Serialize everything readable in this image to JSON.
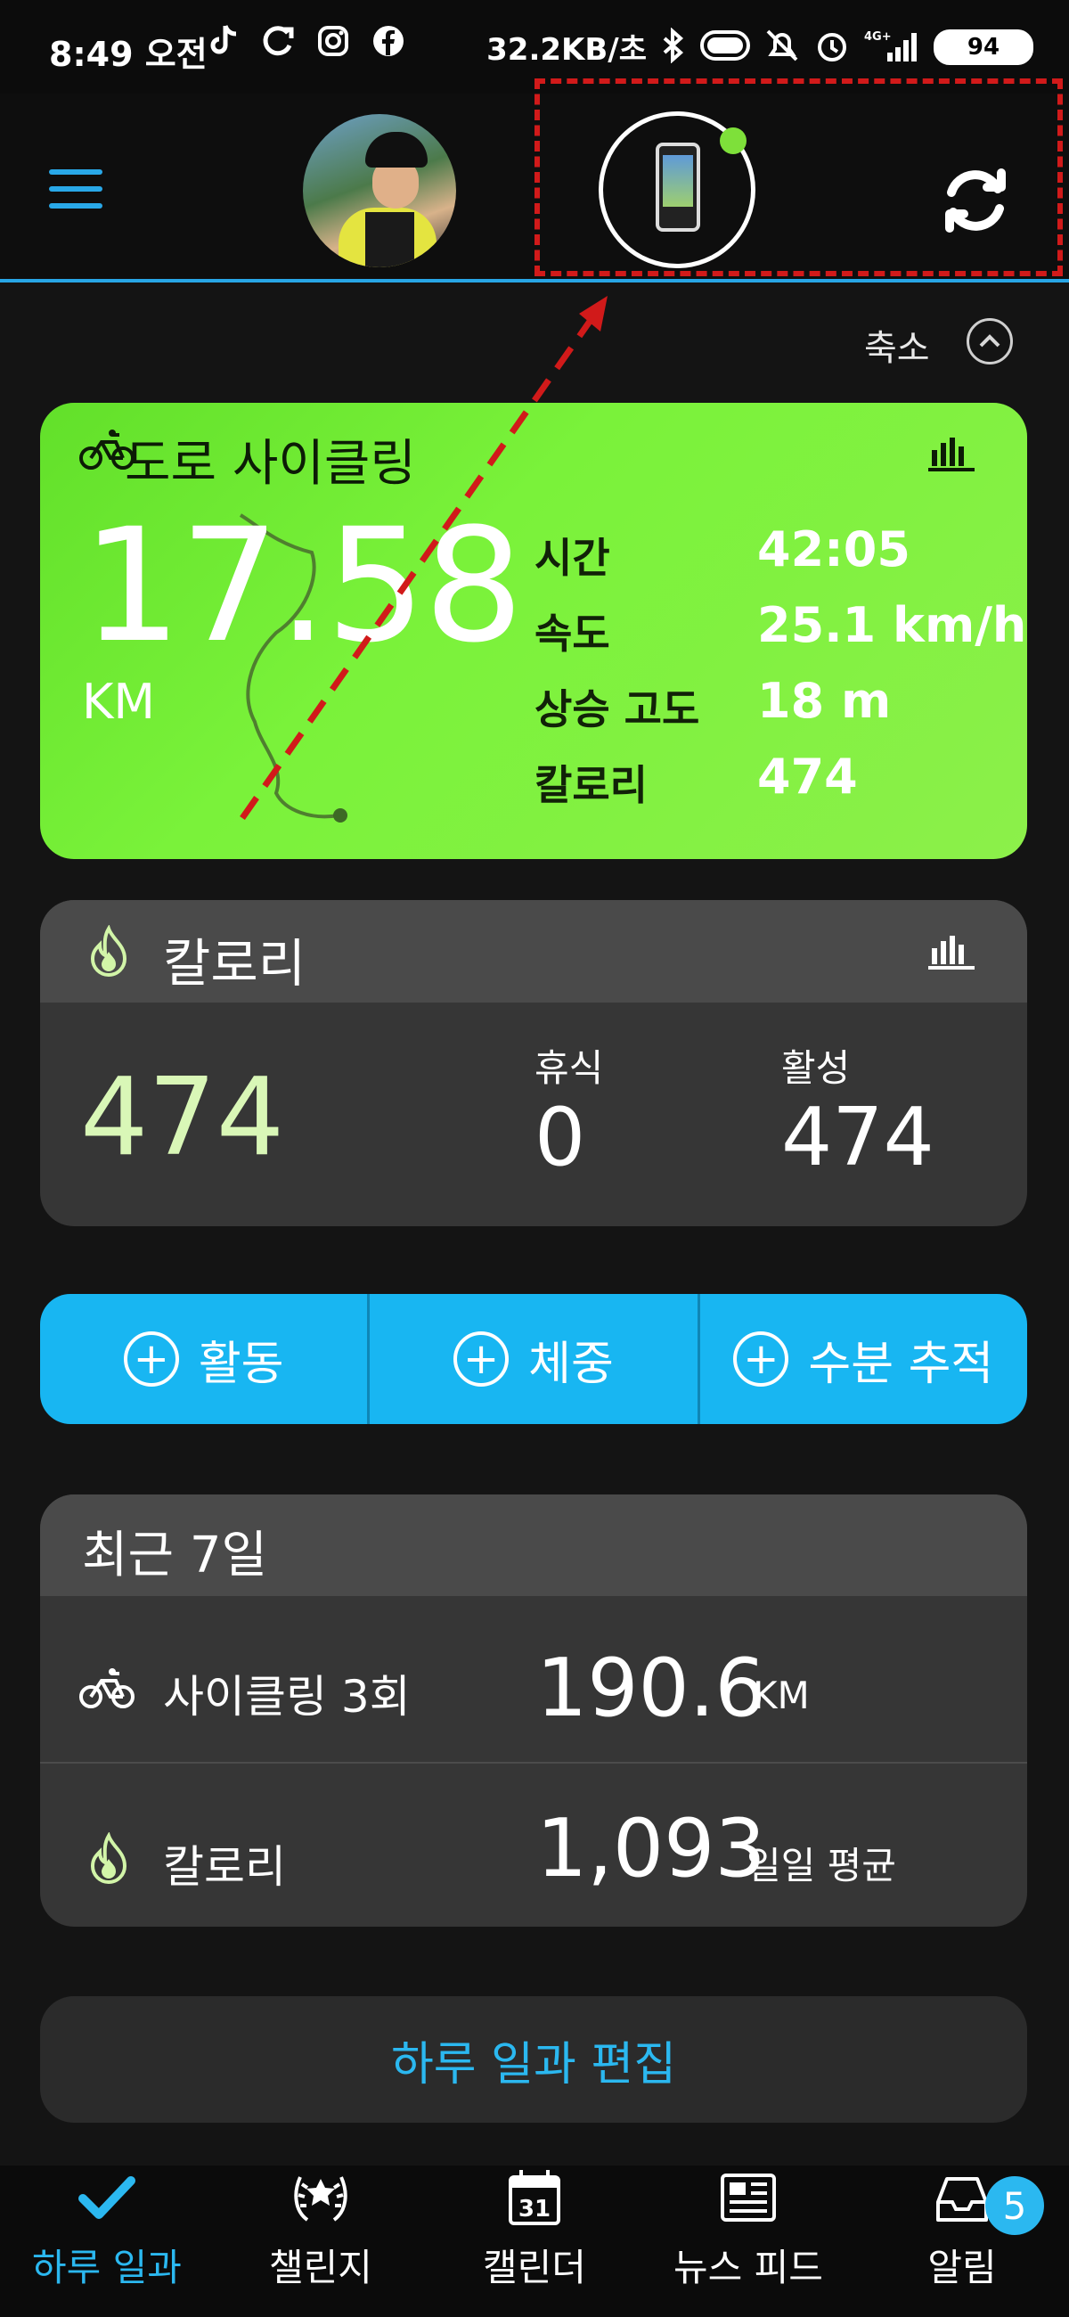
{
  "status_bar": {
    "time": "8:49 오전",
    "network_speed": "32.2KB/초",
    "battery": "94",
    "signal": "4G+"
  },
  "header": {
    "menu_icon": "hamburger-menu-icon",
    "avatar_icon": "cyclist-avatar",
    "device_icon": "gps-bike-computer-icon",
    "sync_icon": "sync-icon"
  },
  "collapse": {
    "label": "축소"
  },
  "activity": {
    "title": "도로 사이클링",
    "distance": "17.58",
    "unit": "KM",
    "stats": [
      {
        "label": "시간",
        "value": "42:05"
      },
      {
        "label": "속도",
        "value": "25.1 km/h"
      },
      {
        "label": "상승 고도",
        "value": "18 m"
      },
      {
        "label": "칼로리",
        "value": "474"
      }
    ],
    "accent": "#6EE83A"
  },
  "calories": {
    "title": "칼로리",
    "total": "474",
    "rest_label": "휴식",
    "rest_value": "0",
    "active_label": "활성",
    "active_value": "474"
  },
  "actions": [
    {
      "label": "활동"
    },
    {
      "label": "체중"
    },
    {
      "label": "수분 추적"
    }
  ],
  "recent": {
    "title": "최근 7일",
    "rows": [
      {
        "label": "사이클링 3회",
        "value": "190.6",
        "unit": "KM"
      },
      {
        "label": "칼로리",
        "value": "1,093",
        "unit": "일일 평균"
      }
    ]
  },
  "edit": {
    "label": "하루 일과 편집"
  },
  "bottom_nav": {
    "items": [
      {
        "label": "하루 일과",
        "icon": "checkmark-icon"
      },
      {
        "label": "챌린지",
        "icon": "laurel-trophy-icon"
      },
      {
        "label": "캘린더",
        "icon": "calendar-icon",
        "day": "31"
      },
      {
        "label": "뉴스 피드",
        "icon": "newspaper-icon"
      },
      {
        "label": "알림",
        "icon": "inbox-icon",
        "badge": "5"
      }
    ],
    "accent": "#2BB8F0"
  }
}
